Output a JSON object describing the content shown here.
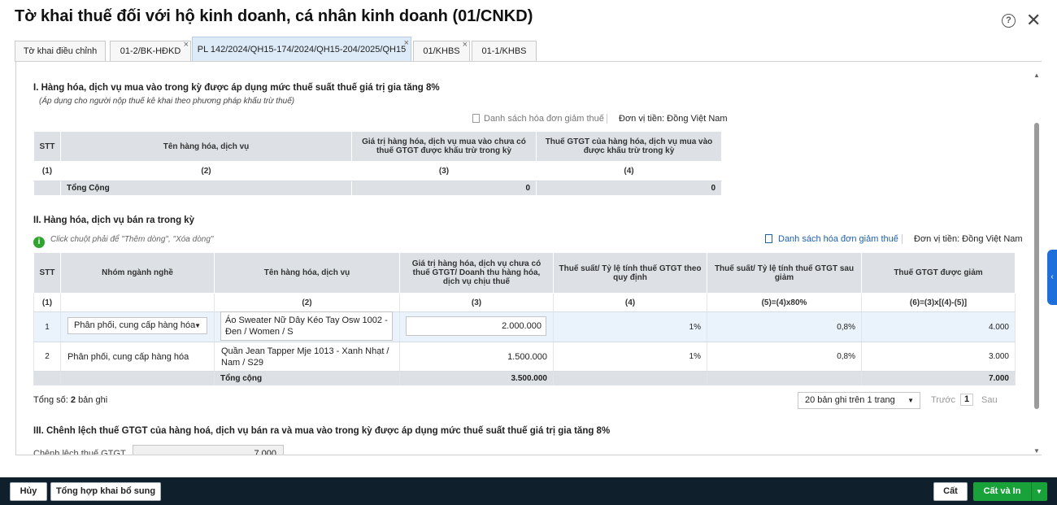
{
  "dialog": {
    "title": "Tờ khai thuế đối với hộ kinh doanh, cá nhân kinh doanh (01/CNKD)",
    "help_icon": "?",
    "close_icon": "✕"
  },
  "tabs": [
    {
      "label": "Tờ khai điều chỉnh",
      "closable": false
    },
    {
      "label": "01-2/BK-HĐKD",
      "closable": true
    },
    {
      "label": "PL 142/2024/QH15-174/2024/QH15-204/2025/QH15",
      "closable": true,
      "active": true
    },
    {
      "label": "01/KHBS",
      "closable": true
    },
    {
      "label": "01-1/KHBS",
      "closable": false
    }
  ],
  "section1": {
    "title": "I. Hàng hóa, dịch vụ mua vào trong kỳ được áp dụng mức thuế suất thuế giá trị gia tăng 8%",
    "note": "(Áp dụng cho người nộp thuế kê khai theo phương pháp khấu trừ thuế)",
    "invoice_list_link": "Danh sách hóa đơn giảm thuế",
    "currency": "Đơn vị tiền: Đồng Việt Nam",
    "headers": [
      "STT",
      "Tên hàng hóa, dịch vụ",
      "Giá trị hàng hóa, dịch vụ mua vào chưa có thuế GTGT được khấu trừ trong kỳ",
      "Thuế GTGT của hàng hóa, dịch vụ mua vào được khấu trừ trong kỳ"
    ],
    "index_row": [
      "(1)",
      "(2)",
      "(3)",
      "(4)"
    ],
    "total_label": "Tổng Cộng",
    "total_value": "0",
    "total_tax": "0"
  },
  "section2": {
    "title": "II. Hàng hóa, dịch vụ bán ra trong kỳ",
    "hint_icon": "i",
    "hint": "Click chuột phải để \"Thêm dòng\", \"Xóa dòng\"",
    "invoice_list_link": "Danh sách hóa đơn giảm thuế",
    "currency": "Đơn vị tiền: Đồng Việt Nam",
    "headers": [
      "STT",
      "Nhóm ngành nghề",
      "Tên hàng hóa, dịch vụ",
      "Giá trị hàng hóa, dịch vụ chưa có thuế GTGT/ Doanh thu hàng hóa, dịch vụ chịu thuế",
      "Thuế suất/ Tỷ lệ tính thuế GTGT theo quy định",
      "Thuế suất/ Tỷ lệ tính thuế GTGT sau giảm",
      "Thuế GTGT được giảm"
    ],
    "index_row": [
      "(1)",
      "",
      "(2)",
      "(3)",
      "(4)",
      "(5)=(4)x80%",
      "(6)=(3)x[(4)-(5)]"
    ],
    "rows": [
      {
        "stt": "1",
        "group": "Phân phối, cung cấp hàng hóa",
        "name": "Áo  Sweater Nữ Dây Kéo Tay Osw 1002 - Đen / Women / S",
        "value": "2.000.000",
        "rate": "1%",
        "reduced_rate": "0,8%",
        "tax": "4.000"
      },
      {
        "stt": "2",
        "group": "Phân phối, cung cấp hàng hóa",
        "name": "Quần Jean Tapper Mje 1013 - Xanh Nhạt / Nam / S29",
        "value": "1.500.000",
        "rate": "1%",
        "reduced_rate": "0,8%",
        "tax": "3.000"
      }
    ],
    "total_label": "Tổng cộng",
    "total_value": "3.500.000",
    "total_tax": "7.000",
    "record_count_label": "Tổng số:",
    "record_count_value": "2",
    "record_count_unit": "bản ghi",
    "page_size": "20 bản ghi trên 1 trang",
    "prev": "Trước",
    "page": "1",
    "next": "Sau"
  },
  "section3": {
    "title": "III. Chênh lệch thuế GTGT của hàng hoá, dịch vụ bán ra và mua vào trong kỳ được áp dụng mức thuế suất thuế giá trị gia tăng 8%",
    "diff_label": "Chênh lệch thuế GTGT",
    "diff_value": "7.000"
  },
  "footer": {
    "cancel": "Hủy",
    "summary": "Tổng hợp khai bổ sung",
    "save": "Cất",
    "save_print": "Cất và In"
  }
}
